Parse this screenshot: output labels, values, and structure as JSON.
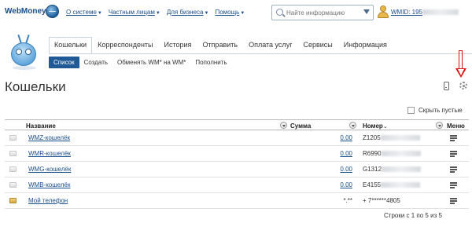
{
  "header": {
    "logo_text": "WebMoney",
    "nav": [
      "О системе",
      "Частным лицам",
      "Для бизнеса",
      "Помощь"
    ],
    "search_placeholder": "Найте информацию",
    "wmid_label": "WMID: 195"
  },
  "tabs": [
    "Кошельки",
    "Корреспонденты",
    "История",
    "Отправить",
    "Оплата услуг",
    "Сервисы",
    "Информация"
  ],
  "subtabs": [
    "Список",
    "Создать",
    "Обменять WM* на WM*",
    "Пополнить"
  ],
  "page_title": "Кошельки",
  "hide_empty_label": "Скрыть пустые",
  "table": {
    "columns": {
      "name": "Название",
      "amount": "Сумма",
      "number": "Номер",
      "menu": "Меню"
    },
    "rows": [
      {
        "name": "WMZ-кошелёк",
        "amount": "0.00",
        "number_prefix": "Z1205"
      },
      {
        "name": "WMR-кошелёк",
        "amount": "0.00",
        "number_prefix": "R6990"
      },
      {
        "name": "WMG-кошелёк",
        "amount": "0.00",
        "number_prefix": "G1312"
      },
      {
        "name": "WMB-кошелёк",
        "amount": "0.00",
        "number_prefix": "E4155"
      },
      {
        "name": "Мой телефон",
        "amount": "*.**",
        "number_prefix": "+ 7******4805"
      }
    ],
    "footer": "Строки с 1 по 5 из 5"
  }
}
